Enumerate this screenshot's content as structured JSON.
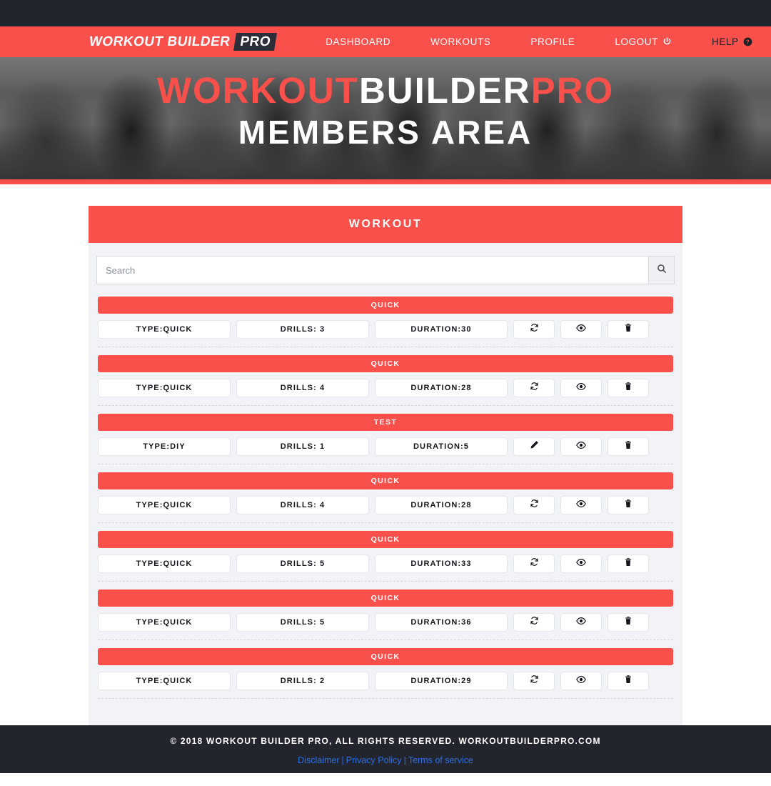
{
  "theme": {
    "accent_red": "#f9504b",
    "dark_navy": "#22252e",
    "card_bg": "#f2f3f6",
    "link_blue": "#2f6fe0"
  },
  "navbar": {
    "logo_main": "WORKOUT BUILDER",
    "logo_badge": "PRO",
    "items": [
      {
        "label": "DASHBOARD",
        "icon": "",
        "style": "light"
      },
      {
        "label": "WORKOUTS",
        "icon": "",
        "style": "light"
      },
      {
        "label": "PROFILE",
        "icon": "",
        "style": "light"
      },
      {
        "label": "LOGOUT",
        "icon": "power-icon",
        "style": "light"
      },
      {
        "label": "HELP",
        "icon": "question-circle-icon",
        "style": "dark"
      }
    ]
  },
  "hero": {
    "line1_part1": "WORKOUT",
    "line1_part2": "BUILDER",
    "line1_part3": "PRO",
    "line2": "MEMBERS AREA"
  },
  "card": {
    "header_title": "WORKOUT",
    "search": {
      "placeholder": "Search",
      "value": "",
      "button_icon": "search-icon"
    },
    "rows": [
      {
        "title": "QUICK",
        "type": "TYPE:QUICK",
        "drills": "DRILLS: 3",
        "duration": "DURATION:30",
        "action_icon": "refresh-icon",
        "view_icon": "eye-icon",
        "delete_icon": "trash-icon"
      },
      {
        "title": "QUICK",
        "type": "TYPE:QUICK",
        "drills": "DRILLS: 4",
        "duration": "DURATION:28",
        "action_icon": "refresh-icon",
        "view_icon": "eye-icon",
        "delete_icon": "trash-icon"
      },
      {
        "title": "TEST",
        "type": "TYPE:DIY",
        "drills": "DRILLS: 1",
        "duration": "DURATION:5",
        "action_icon": "pencil-icon",
        "view_icon": "eye-icon",
        "delete_icon": "trash-icon"
      },
      {
        "title": "QUICK",
        "type": "TYPE:QUICK",
        "drills": "DRILLS: 4",
        "duration": "DURATION:28",
        "action_icon": "refresh-icon",
        "view_icon": "eye-icon",
        "delete_icon": "trash-icon"
      },
      {
        "title": "QUICK",
        "type": "TYPE:QUICK",
        "drills": "DRILLS: 5",
        "duration": "DURATION:33",
        "action_icon": "refresh-icon",
        "view_icon": "eye-icon",
        "delete_icon": "trash-icon"
      },
      {
        "title": "QUICK",
        "type": "TYPE:QUICK",
        "drills": "DRILLS: 5",
        "duration": "DURATION:36",
        "action_icon": "refresh-icon",
        "view_icon": "eye-icon",
        "delete_icon": "trash-icon"
      },
      {
        "title": "QUICK",
        "type": "TYPE:QUICK",
        "drills": "DRILLS: 2",
        "duration": "DURATION:29",
        "action_icon": "refresh-icon",
        "view_icon": "eye-icon",
        "delete_icon": "trash-icon"
      }
    ]
  },
  "footer": {
    "copyright": "© 2018 WORKOUT BUILDER PRO, ALL RIGHTS RESERVED. WORKOUTBUILDERPRO.COM",
    "links": [
      "Disclaimer",
      "Privacy Policy",
      "Terms of service"
    ],
    "separator": "|"
  }
}
